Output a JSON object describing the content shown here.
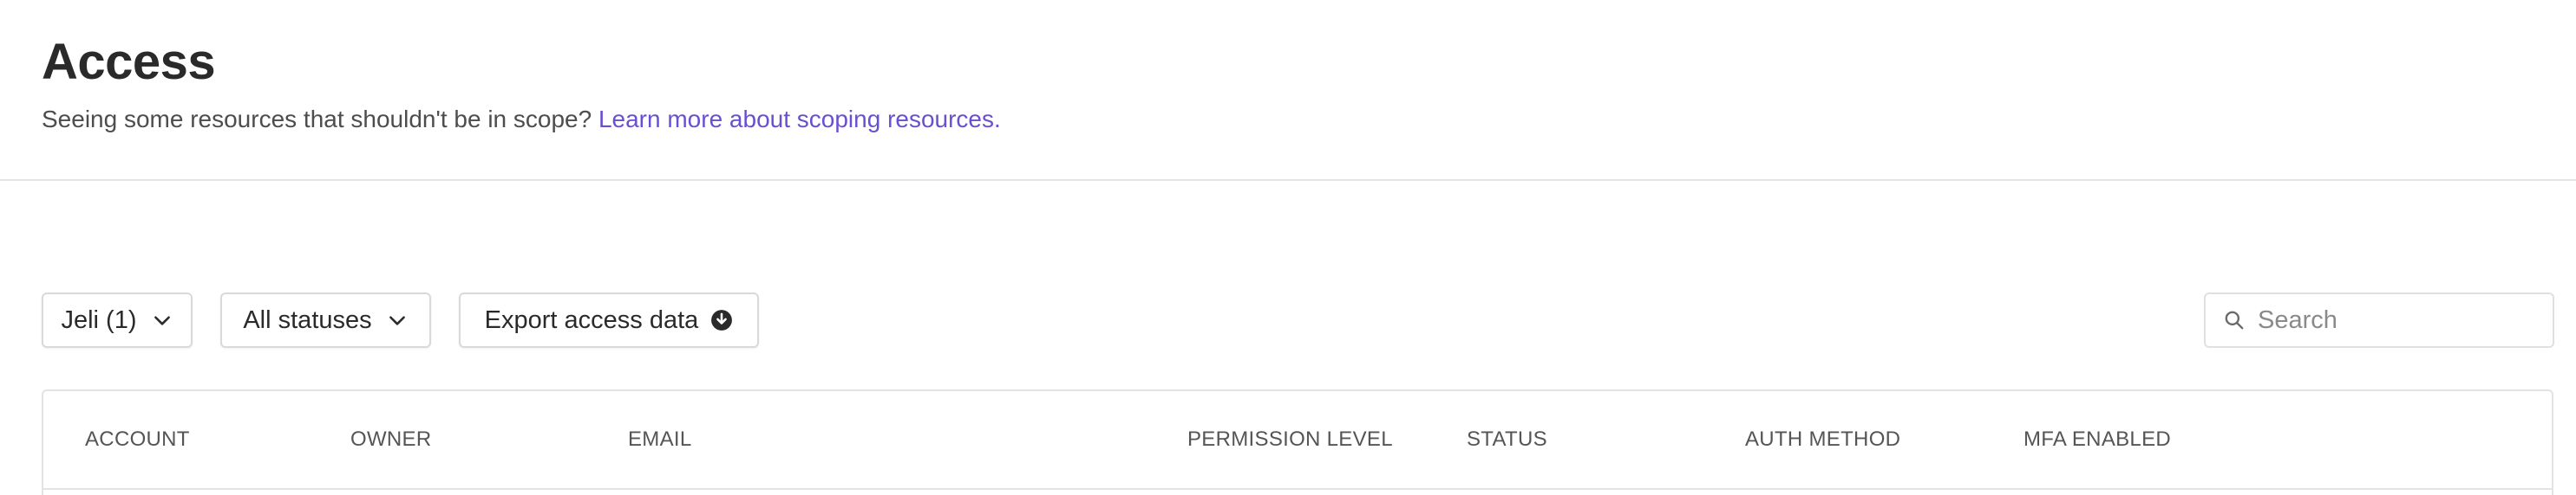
{
  "header": {
    "title": "Access",
    "subtitle_text": "Seeing some resources that shouldn't be in scope? ",
    "subtitle_link": "Learn more about scoping resources."
  },
  "toolbar": {
    "account_filter_label": "Jeli (1)",
    "status_filter_label": "All statuses",
    "export_label": "Export access data",
    "search_placeholder": "Search"
  },
  "table": {
    "columns": [
      "ACCOUNT",
      "OWNER",
      "EMAIL",
      "PERMISSION LEVEL",
      "STATUS",
      "AUTH METHOD",
      "MFA ENABLED"
    ]
  },
  "colors": {
    "link": "#6a4fd0",
    "border": "#e3e3e3",
    "text": "#2a2a2a"
  },
  "icons": {
    "dropdown": "chevron-down-icon",
    "export": "download-circle-icon",
    "search": "search-icon"
  }
}
